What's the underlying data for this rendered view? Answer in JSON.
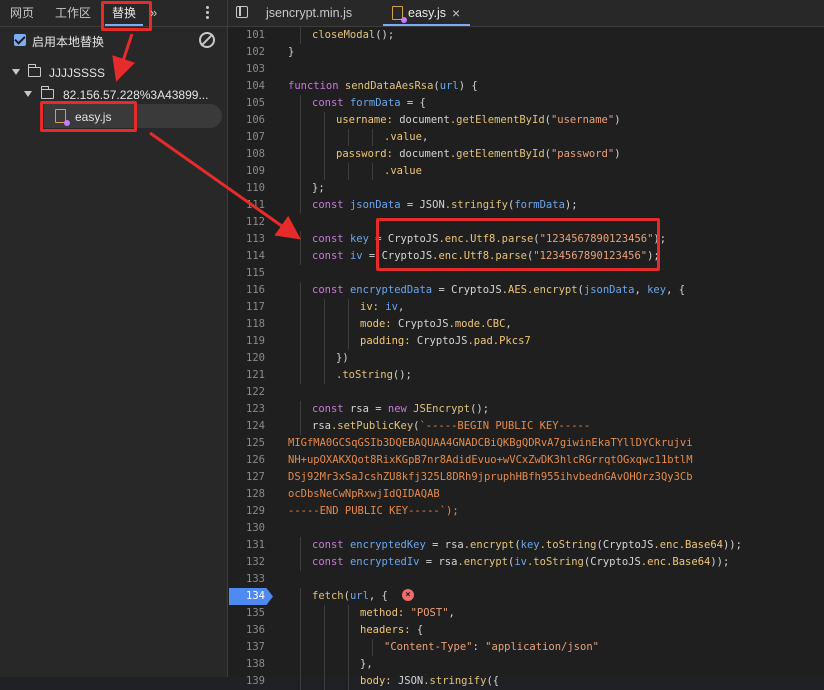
{
  "left_pane": {
    "tabs": [
      {
        "label": "网页"
      },
      {
        "label": "工作区"
      },
      {
        "label": "替换"
      }
    ],
    "more_symbol": "»",
    "local_override": {
      "label": "启用本地替换",
      "checked": true
    },
    "tree": {
      "root_folder": "JJJJSSSS",
      "sub_folder": "82.156.57.228%3A43899...",
      "file": "easy.js"
    }
  },
  "editor": {
    "tabs": [
      {
        "label": "jsencrypt.min.js"
      },
      {
        "label": "easy.js"
      }
    ],
    "close_symbol": "×",
    "error_symbol": "×",
    "breakpoint_line": "134"
  },
  "code_lines": [
    {
      "n": "101",
      "t": "closeModal();"
    },
    {
      "n": "102",
      "t": "}"
    },
    {
      "n": "103",
      "t": ""
    },
    {
      "n": "104",
      "t": "function sendDataAesRsa(url) {"
    },
    {
      "n": "105",
      "t": "const formData = {"
    },
    {
      "n": "106",
      "t": "username: document.getElementById(\"username\")"
    },
    {
      "n": "107",
      "t": ".value,"
    },
    {
      "n": "108",
      "t": "password: document.getElementById(\"password\")"
    },
    {
      "n": "109",
      "t": ".value"
    },
    {
      "n": "110",
      "t": "};"
    },
    {
      "n": "111",
      "t": "const jsonData = JSON.stringify(formData);"
    },
    {
      "n": "112",
      "t": ""
    },
    {
      "n": "113",
      "t": "const key = CryptoJS.enc.Utf8.parse(\"1234567890123456\");"
    },
    {
      "n": "114",
      "t": "const iv = CryptoJS.enc.Utf8.parse(\"1234567890123456\");"
    },
    {
      "n": "115",
      "t": ""
    },
    {
      "n": "116",
      "t": "const encryptedData = CryptoJS.AES.encrypt(jsonData, key, {"
    },
    {
      "n": "117",
      "t": "iv: iv,"
    },
    {
      "n": "118",
      "t": "mode: CryptoJS.mode.CBC,"
    },
    {
      "n": "119",
      "t": "padding: CryptoJS.pad.Pkcs7"
    },
    {
      "n": "120",
      "t": "})"
    },
    {
      "n": "121",
      "t": ".toString();"
    },
    {
      "n": "122",
      "t": ""
    },
    {
      "n": "123",
      "t": "const rsa = new JSEncrypt();"
    },
    {
      "n": "124",
      "t": "rsa.setPublicKey(`-----BEGIN PUBLIC KEY-----"
    },
    {
      "n": "125",
      "t": "MIGfMA0GCSqGSIb3DQEBAQUAA4GNADCBiQKBgQDRvA7giwinEkaTYllDYCkrujvi"
    },
    {
      "n": "126",
      "t": "NH+upOXAKXQot8RixKGpB7nr8AdidEvuo+wVCxZwDK3hlcRGrrqtOGxqwc11btlM"
    },
    {
      "n": "127",
      "t": "DSj92Mr3xSaJcshZU8kfj325L8DRh9jpruphHBfh955ihvbednGAvOHOrz3Qy3Cb"
    },
    {
      "n": "128",
      "t": "ocDbsNeCwNpRxwjIdQIDAQAB"
    },
    {
      "n": "129",
      "t": "-----END PUBLIC KEY-----`);"
    },
    {
      "n": "130",
      "t": ""
    },
    {
      "n": "131",
      "t": "const encryptedKey = rsa.encrypt(key.toString(CryptoJS.enc.Base64));"
    },
    {
      "n": "132",
      "t": "const encryptedIv = rsa.encrypt(iv.toString(CryptoJS.enc.Base64));"
    },
    {
      "n": "133",
      "t": ""
    },
    {
      "n": "134",
      "t": "fetch(url, {"
    },
    {
      "n": "135",
      "t": "method: \"POST\","
    },
    {
      "n": "136",
      "t": "headers: {"
    },
    {
      "n": "137",
      "t": "\"Content-Type\": \"application/json\""
    },
    {
      "n": "138",
      "t": "},"
    },
    {
      "n": "139",
      "t": "body: JSON.stringify({"
    }
  ]
}
